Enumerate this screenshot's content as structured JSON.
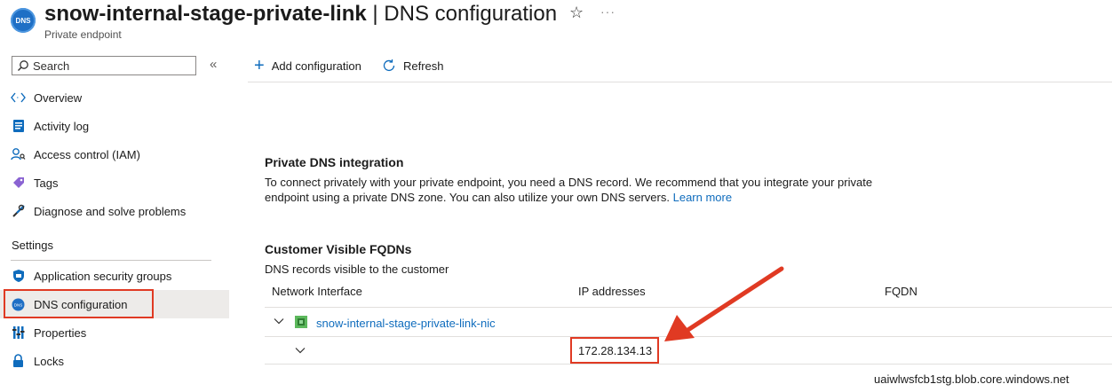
{
  "header": {
    "icon_text": "DNS",
    "title_bold": "snow-internal-stage-private-link",
    "title_rest": " | DNS configuration",
    "subtitle": "Private endpoint",
    "star_icon": "star-icon",
    "more_icon": "more-icon"
  },
  "sidebar": {
    "search_placeholder": "Search",
    "collapse_glyph": "«",
    "items": [
      {
        "label": "Overview",
        "icon": "overview-icon"
      },
      {
        "label": "Activity log",
        "icon": "activity-log-icon"
      },
      {
        "label": "Access control (IAM)",
        "icon": "iam-icon"
      },
      {
        "label": "Tags",
        "icon": "tag-icon"
      },
      {
        "label": "Diagnose and solve problems",
        "icon": "wrench-icon"
      }
    ],
    "section_settings": "Settings",
    "settings_items": [
      {
        "label": "Application security groups",
        "icon": "asg-icon"
      },
      {
        "label": "DNS configuration",
        "icon": "dns-icon",
        "selected": true
      },
      {
        "label": "Properties",
        "icon": "properties-icon"
      },
      {
        "label": "Locks",
        "icon": "lock-icon"
      }
    ]
  },
  "toolbar": {
    "add_label": "Add configuration",
    "refresh_label": "Refresh"
  },
  "content": {
    "dns_heading": "Private DNS integration",
    "dns_desc": "To connect privately with your private endpoint, you need a DNS record. We recommend that you integrate your private endpoint using a private DNS zone. You can also utilize your own DNS servers.",
    "learn_more": "Learn more",
    "fqdn_heading": "Customer Visible FQDNs",
    "fqdn_desc": "DNS records visible to the customer",
    "columns": [
      "Network Interface",
      "IP addresses",
      "FQDN"
    ],
    "nic_name": "snow-internal-stage-private-link-nic",
    "ip_address": "172.28.134.13",
    "fqdn_value": "uaiwlwsfcb1stg.blob.core.windows.net"
  },
  "colors": {
    "accent": "#0f6cbd",
    "highlight": "#e03a23",
    "selected_bg": "#edebe9"
  }
}
